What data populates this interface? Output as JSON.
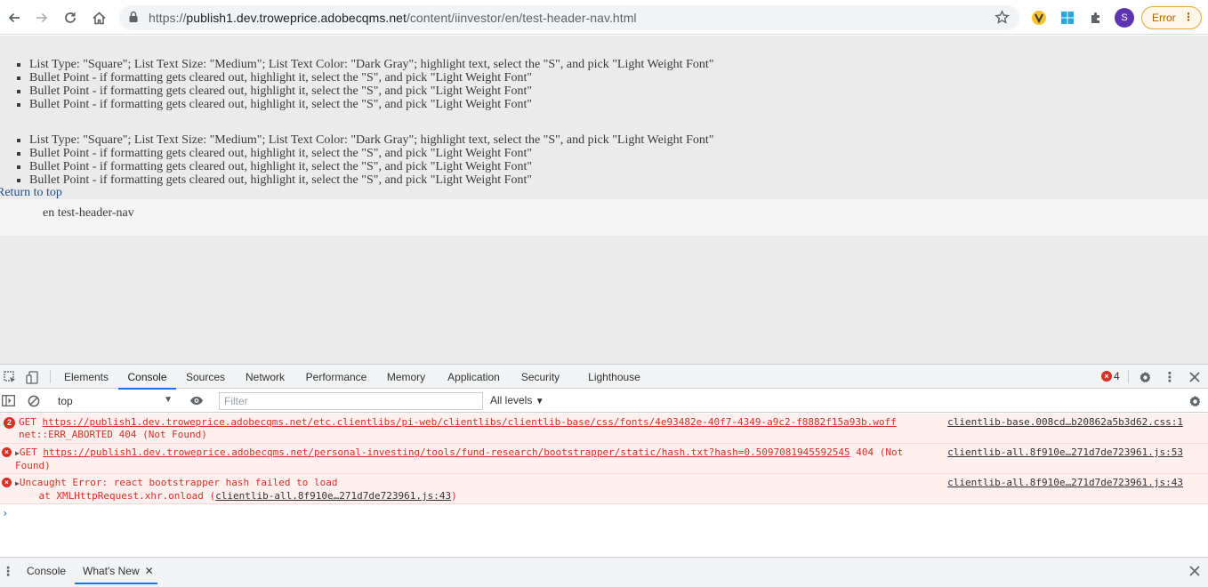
{
  "browser": {
    "url_prefix": "https://",
    "url_host": "publish1.dev.troweprice.adobecqms.net",
    "url_path": "/content/iinvestor/en/test-header-nav.html",
    "avatar_initial": "S",
    "error_label": "Error",
    "menu_glyph": "⋮"
  },
  "page": {
    "list1": [
      "List Type: \"Square\"; List Text Size: \"Medium\"; List Text Color: \"Dark Gray\"; highlight text, select the \"S\", and pick \"Light Weight Font\"",
      "Bullet Point - if formatting gets cleared out, highlight it, select the \"S\", and pick \"Light Weight Font\"",
      "Bullet Point - if formatting gets cleared out, highlight it, select the \"S\", and pick \"Light Weight Font\"",
      "Bullet Point - if formatting gets cleared out, highlight it, select the \"S\", and pick \"Light Weight Font\""
    ],
    "list2": [
      "List Type: \"Square\"; List Text Size: \"Medium\"; List Text Color: \"Dark Gray\"; highlight text, select the \"S\", and pick \"Light Weight Font\"",
      "Bullet Point - if formatting gets cleared out, highlight it, select the \"S\", and pick \"Light Weight Font\"",
      "Bullet Point - if formatting gets cleared out, highlight it, select the \"S\", and pick \"Light Weight Font\"",
      "Bullet Point - if formatting gets cleared out, highlight it, select the \"S\", and pick \"Light Weight Font\""
    ],
    "return_to_top": "Return to top",
    "breadcrumb": "en test-header-nav"
  },
  "devtools": {
    "tabs": [
      "Elements",
      "Console",
      "Sources",
      "Network",
      "Performance",
      "Memory",
      "Application",
      "Security",
      "Lighthouse"
    ],
    "active_tab": "Console",
    "error_count": "4",
    "context": "top",
    "filter_placeholder": "Filter",
    "levels": "All levels",
    "messages": [
      {
        "badge": "2",
        "method": "GET",
        "url": "https://publish1.dev.troweprice.adobecqms.net/etc.clientlibs/pi-web/clientlibs/clientlib-base/css/fonts/4e93482e-40f7-4349-a9c2-f8882f15a93b.woff",
        "detail": "net::ERR_ABORTED 404 (Not Found)",
        "source": "clientlib-base.008cd…b20862a5b3d62.css:1"
      },
      {
        "method": "GET",
        "url": "https://publish1.dev.troweprice.adobecqms.net/personal-investing/tools/fund-research/bootstrapper/static/hash.txt?hash=0.5097081945592545",
        "status_a": "404 (Not",
        "status_b": "Found)",
        "source": "clientlib-all.8f910e…271d7de723961.js:53"
      },
      {
        "text": "Uncaught Error: react bootstrapper hash failed to load",
        "at_prefix": "    at XMLHttpRequest.xhr.onload (",
        "at_link": "clientlib-all.8f910e…271d7de723961.js:43",
        "at_suffix": ")",
        "source": "clientlib-all.8f910e…271d7de723961.js:43"
      }
    ],
    "prompt": "›",
    "drawer_tabs": [
      "Console",
      "What's New"
    ],
    "drawer_active": "What's New"
  }
}
